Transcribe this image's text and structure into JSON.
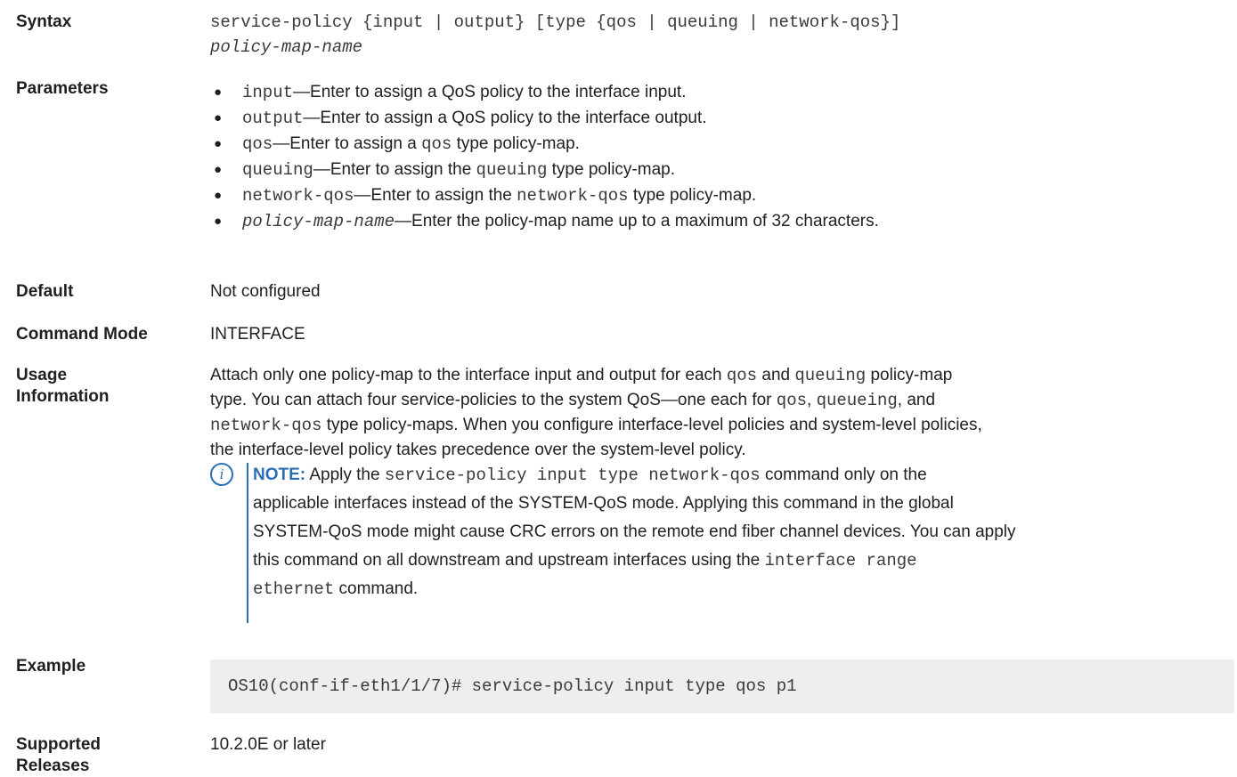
{
  "syntax": {
    "label": "Syntax",
    "line1": "service-policy {input | output} [type {qos | queuing | network-qos}]",
    "line2": "policy-map-name"
  },
  "parameters": {
    "label": "Parameters",
    "items": [
      {
        "code": "input",
        "text": "—Enter to assign a QoS policy to the interface input."
      },
      {
        "code": "output",
        "text": "—Enter to assign a QoS policy to the interface output."
      },
      {
        "code": "qos",
        "text_pre": "—Enter to assign a ",
        "code2": "qos",
        "text_post": " type policy-map."
      },
      {
        "code": "queuing",
        "text_pre": "—Enter to assign the ",
        "code2": "queuing",
        "text_post": " type policy-map."
      },
      {
        "code": "network-qos",
        "text_pre": "—Enter to assign the ",
        "code2": "network-qos",
        "text_post": " type policy-map."
      },
      {
        "code": "policy-map-name",
        "text": "—Enter the policy-map name up to a maximum of 32 characters."
      }
    ]
  },
  "default": {
    "label": "Default",
    "value": "Not configured"
  },
  "command_mode": {
    "label": "Command Mode",
    "value": "INTERFACE"
  },
  "usage": {
    "label1": "Usage",
    "label2": "Information",
    "t1": "Attach only one policy-map to the interface input and output for each ",
    "c1": "qos",
    "t2": " and ",
    "c2": "queuing",
    "t3": " policy-map",
    "t4": "type. You can attach four service-policies to the system QoS—one each for ",
    "c3": "qos",
    "t5": ", ",
    "c4": "queueing",
    "t6": ", and",
    "c5": "network-qos",
    "t7": " type policy-maps. When you configure interface-level policies and system-level policies,",
    "t8": "the interface-level policy takes precedence over the system-level policy."
  },
  "note": {
    "label": "NOTE:",
    "t1": " Apply the ",
    "c1": "service-policy input type network-qos",
    "t2": " command only on the",
    "t3": "applicable interfaces instead of the SYSTEM-QoS mode. Applying this command in the global",
    "t4": "SYSTEM-QoS mode might cause CRC errors on the remote end fiber channel devices. You can apply",
    "t5": "this command on all downstream and upstream interfaces using the ",
    "c2": "interface range",
    "c3": "ethernet",
    "t6": " command."
  },
  "example": {
    "label": "Example",
    "code": "OS10(conf-if-eth1/1/7)# service-policy input type qos p1"
  },
  "supported_releases": {
    "label1": "Supported",
    "label2": "Releases",
    "value": "10.2.0E or later"
  }
}
